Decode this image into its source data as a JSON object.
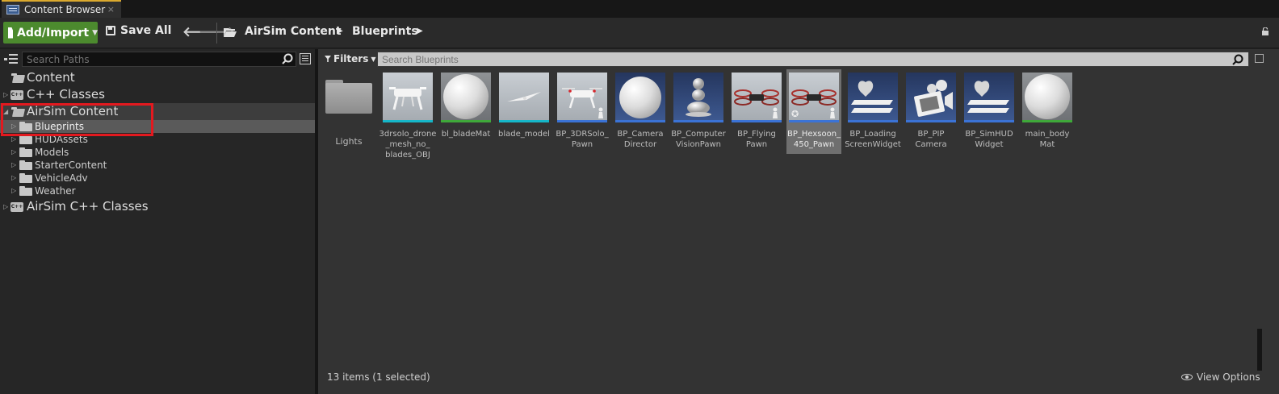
{
  "tab": {
    "title": "Content Browser",
    "close": "×"
  },
  "toolbar": {
    "add_import": "Add/Import",
    "save_all": "Save All",
    "breadcrumbs": [
      "AirSim Content",
      "Blueprints"
    ]
  },
  "left": {
    "search_placeholder": "Search Paths",
    "tree": [
      {
        "label": "Content"
      },
      {
        "label": "C++ Classes"
      },
      {
        "label": "AirSim Content"
      },
      {
        "label": "Blueprints"
      },
      {
        "label": "HUDAssets"
      },
      {
        "label": "Models"
      },
      {
        "label": "StarterContent"
      },
      {
        "label": "VehicleAdv"
      },
      {
        "label": "Weather"
      },
      {
        "label": "AirSim C++ Classes"
      }
    ]
  },
  "right": {
    "filters_label": "Filters",
    "search_placeholder": "Search Blueprints",
    "assets": [
      {
        "label": "Lights"
      },
      {
        "label": "3drsolo_drone\n_mesh_no_\nblades_OBJ",
        "color": "#16b6c8"
      },
      {
        "label": "bl_bladeMat",
        "color": "#3fa83a"
      },
      {
        "label": "blade_model",
        "color": "#16b6c8"
      },
      {
        "label": "BP_3DRSolo_\nPawn",
        "color": "#3b73d6"
      },
      {
        "label": "BP_Camera\nDirector",
        "color": "#3b73d6"
      },
      {
        "label": "BP_Computer\nVisionPawn",
        "color": "#3b73d6"
      },
      {
        "label": "BP_Flying\nPawn",
        "color": "#3b73d6"
      },
      {
        "label": "BP_Hexsoon_\n450_Pawn",
        "color": "#3b73d6"
      },
      {
        "label": "BP_Loading\nScreenWidget",
        "color": "#3b73d6"
      },
      {
        "label": "BP_PIP\nCamera",
        "color": "#3b73d6"
      },
      {
        "label": "BP_SimHUD\nWidget",
        "color": "#3b73d6"
      },
      {
        "label": "main_body\nMat",
        "color": "#3fa83a"
      }
    ],
    "status": "13 items (1 selected)",
    "view_options": "View Options"
  }
}
